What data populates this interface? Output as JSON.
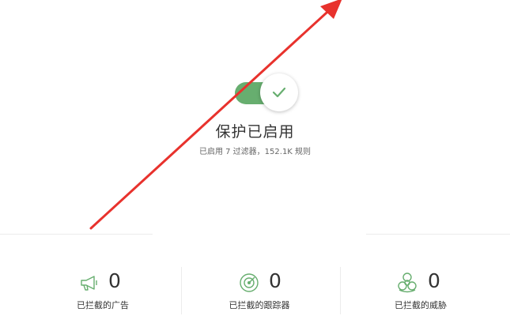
{
  "protection": {
    "toggle_on": true,
    "title": "保护已启用",
    "subtitle": "已启用 7 过滤器，152.1K 规则",
    "accent_color": "#67ae6f"
  },
  "stats": [
    {
      "icon": "megaphone-icon",
      "value": "0",
      "label": "已拦截的广告"
    },
    {
      "icon": "tracker-radar-icon",
      "value": "0",
      "label": "已拦截的跟踪器"
    },
    {
      "icon": "biohazard-icon",
      "value": "0",
      "label": "已拦截的威胁"
    }
  ],
  "annotation": {
    "type": "red-arrow",
    "color": "#e8322d"
  }
}
